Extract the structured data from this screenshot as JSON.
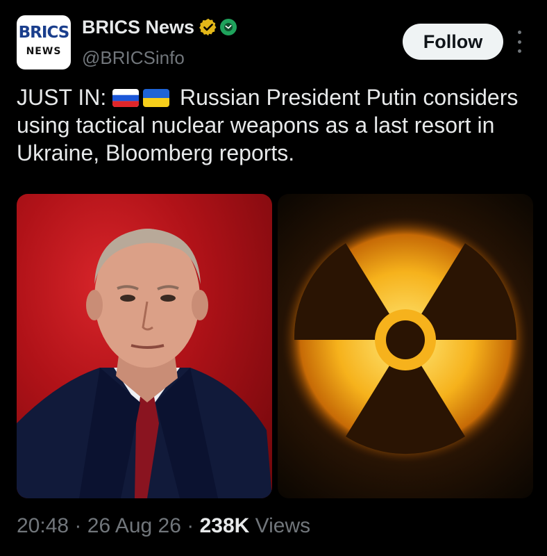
{
  "account": {
    "display_name": "BRICS News",
    "handle": "@BRICSinfo",
    "avatar_text": "BRICS",
    "avatar_subtext": "NEWS",
    "verified": true
  },
  "actions": {
    "follow_label": "Follow",
    "more_icon": "more-vertical-icon"
  },
  "tweet": {
    "prefix": "JUST IN:",
    "body": "Russian President Putin considers using tactical nuclear weapons as a last resort in Ukraine, Bloomberg reports.",
    "flags": [
      "russia-flag",
      "ukraine-flag"
    ]
  },
  "media": [
    {
      "name": "putin-photo",
      "kind": "portrait photo on red background"
    },
    {
      "name": "radiation-symbol-image",
      "kind": "glowing radiation trefoil"
    }
  ],
  "meta": {
    "time": "20:48",
    "separator": "·",
    "date": "26 Aug 26",
    "views_count": "238K",
    "views_label": "Views"
  },
  "colors": {
    "background": "#000000",
    "text_primary": "#e7e9ea",
    "text_secondary": "#71767b",
    "verified_gold": "#e2b719",
    "affiliate_green": "#1fa35c",
    "follow_bg": "#eff3f4"
  }
}
